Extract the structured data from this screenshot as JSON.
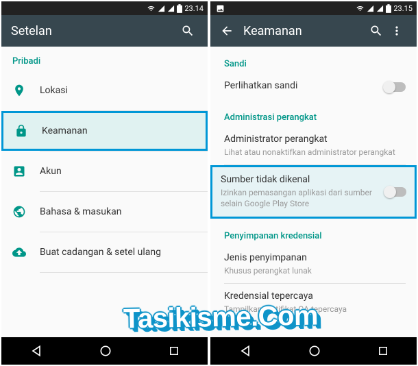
{
  "left": {
    "statusbar": {
      "time": "23.14"
    },
    "appbar": {
      "title": "Setelan"
    },
    "section_personal": "Pribadi",
    "items": {
      "location": "Lokasi",
      "security": "Keamanan",
      "accounts": "Akun",
      "language": "Bahasa & masukan",
      "backup": "Buat cadangan & setel ulang"
    }
  },
  "right": {
    "statusbar": {
      "time": "23.15"
    },
    "appbar": {
      "title": "Keamanan"
    },
    "section_password": "Sandi",
    "show_password": {
      "title": "Perlihatkan sandi"
    },
    "section_admin": "Administrasi perangkat",
    "device_admin": {
      "title": "Administrator perangkat",
      "subtitle": "Lihat atau nonaktifkan administrator perangkat"
    },
    "unknown_sources": {
      "title": "Sumber tidak dikenal",
      "subtitle": "Izinkan pemasangan aplikasi dari sumber selain Google Play Store"
    },
    "section_cred": "Penyimpanan kredensial",
    "storage_type": {
      "title": "Jenis penyimpanan",
      "subtitle": "Khusus perangkat lunak"
    },
    "trusted_creds": {
      "title": "Kredensial tepercaya",
      "subtitle": "Tampilkan sertifikat CA tepercaya"
    }
  },
  "watermark": "Tasikisme.Com"
}
